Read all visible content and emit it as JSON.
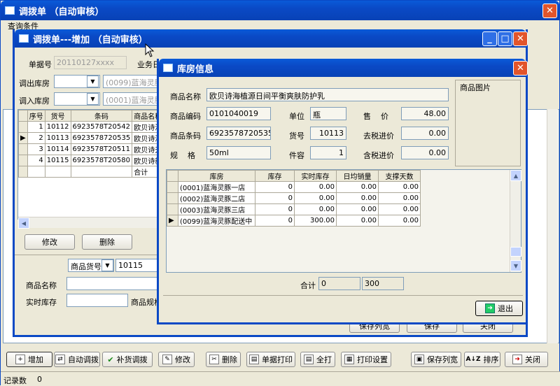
{
  "main_window": {
    "title": "调拨单  （自动审核）",
    "filter_label": "查询条件",
    "status_label": "记录数",
    "status_value": "0"
  },
  "toolbar": {
    "add": "增加",
    "auto_transfer": "自动调拨",
    "restock_transfer": "补货调拨",
    "modify": "修改",
    "delete": "删除",
    "print_doc": "单据打印",
    "print_all": "全打",
    "print_setup": "打印设置",
    "save_columns": "保存列宽",
    "sort": "排序",
    "close": "关闭"
  },
  "add_window": {
    "title": "调拨单---增加  （自动审核）",
    "doc_no_label": "单据号",
    "doc_no_value": "20110127xxxx",
    "biz_label": "业务日",
    "out_store_label": "调出库房",
    "out_store_value": "(0099)蓝海灵豚",
    "in_store_label": "调入库房",
    "in_store_value": "(0001)蓝海灵豚",
    "columns": [
      "序号",
      "货号",
      "条码",
      "商品名称"
    ],
    "rows": [
      {
        "seq": "1",
        "code": "10112",
        "barcode": "6923578T20542",
        "name": "欧贝诗海"
      },
      {
        "seq": "2",
        "code": "10113",
        "barcode": "6923578720535",
        "name": "欧贝诗海"
      },
      {
        "seq": "3",
        "code": "10114",
        "barcode": "6923578T20511",
        "name": "欧贝诗天"
      },
      {
        "seq": "4",
        "code": "10115",
        "barcode": "6923578T20580",
        "name": "欧贝诗新"
      }
    ],
    "total_label": "合计",
    "edit_button": "修改",
    "delete_button": "删除",
    "search_type": "商品货号",
    "search_value": "10115",
    "product_name_label": "商品名称",
    "stock_label": "实时库存",
    "spec_label": "商品规格",
    "save_columns_button": "保存列宽",
    "save_button": "保存",
    "close_button": "关闭"
  },
  "store_dialog": {
    "title": "库房信息",
    "name_label": "商品名称",
    "name_value": "欧贝诗海植源日间平衡爽肤防护乳",
    "code_label": "商品编码",
    "code_value": "0101040019",
    "unit_label": "单位",
    "unit_value": "瓶",
    "price_label": "售    价",
    "price_value": "48.00",
    "barcode_label": "商品条码",
    "barcode_value": "6923578720535",
    "item_no_label": "货号",
    "item_no_value": "10113",
    "ex_tax_label": "去税进价",
    "ex_tax_value": "0.00",
    "spec_label": "规    格",
    "spec_value": "50ml",
    "pack_label": "件容",
    "pack_value": "1",
    "in_tax_label": "含税进价",
    "in_tax_value": "0.00",
    "image_label": "商品图片",
    "columns": [
      "库房",
      "库存",
      "实时库存",
      "日均销量",
      "支撑天数"
    ],
    "rows": [
      {
        "store": "(0001)蓝海灵豚一店",
        "stock": "0",
        "realtime": "0.00",
        "daily": "0.00",
        "days": "0.00"
      },
      {
        "store": "(0002)蓝海灵豚二店",
        "stock": "0",
        "realtime": "0.00",
        "daily": "0.00",
        "days": "0.00"
      },
      {
        "store": "(0003)蓝海灵豚三店",
        "stock": "0",
        "realtime": "0.00",
        "daily": "0.00",
        "days": "0.00"
      },
      {
        "store": "(0099)蓝海灵豚配送中",
        "stock": "0",
        "realtime": "300.00",
        "daily": "0.00",
        "days": "0.00"
      }
    ],
    "total_label": "合计",
    "total_stock": "0",
    "total_realtime": "300",
    "exit_button": "退出"
  }
}
